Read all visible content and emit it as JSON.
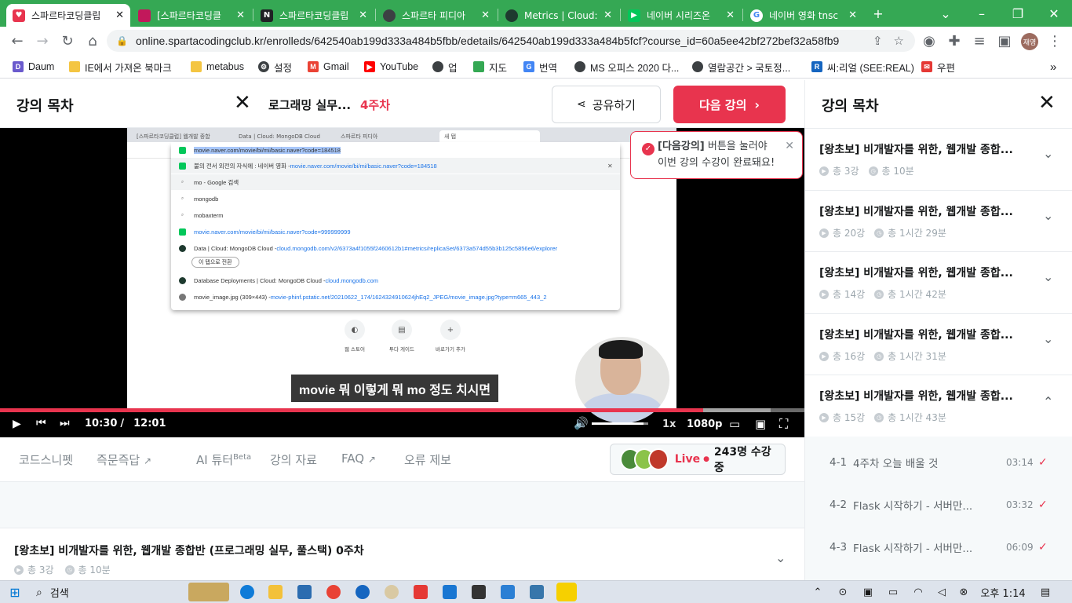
{
  "browser": {
    "tabs": [
      {
        "title": "스파르타코딩클립",
        "active": true,
        "favicon_color": "#e8344e"
      },
      {
        "title": "[스파르타코딩클",
        "active": false,
        "favicon_color": "#c2185b"
      },
      {
        "title": "스파르타코딩클립",
        "active": false,
        "favicon_color": "#202124"
      },
      {
        "title": "스파르타 피디아",
        "active": false,
        "favicon_color": "#3c4043"
      },
      {
        "title": "Metrics | Cloud:",
        "active": false,
        "favicon_color": "#1e3a2f"
      },
      {
        "title": "네이버 시리즈온",
        "active": false,
        "favicon_color": "#03c75a"
      },
      {
        "title": "네이버 영화 tnsc",
        "active": false,
        "favicon_color": "#4285f4"
      }
    ],
    "new_tab": "+",
    "url": "online.spartacodingclub.kr/enrolleds/642540ab199d333a484b5fbb/edetails/642540ab199d333a484b5fcf?course_id=60a5ee42bf272bef32a58fb9",
    "profile_label": "재영",
    "bookmarks": [
      {
        "label": "Daum",
        "icon_color": "#6a5acd"
      },
      {
        "label": "IE에서 가져온 북마크",
        "icon_color": "#f4c542"
      },
      {
        "label": "metabus",
        "icon_color": "#f4c542"
      },
      {
        "label": "설정",
        "icon_color": "#3c4043"
      },
      {
        "label": "Gmail",
        "icon_color": "#ea4335"
      },
      {
        "label": "YouTube",
        "icon_color": "#ff0000"
      },
      {
        "label": "업",
        "icon_color": "#3c4043"
      },
      {
        "label": "지도",
        "icon_color": "#34a853"
      },
      {
        "label": "번역",
        "icon_color": "#4285f4"
      },
      {
        "label": "MS 오피스 2020 다...",
        "icon_color": "#3c4043"
      },
      {
        "label": "열람공간 > 국토정...",
        "icon_color": "#3c4043"
      },
      {
        "label": "씨:리얼 (SEE:REAL)",
        "icon_color": "#1565c0"
      },
      {
        "label": "우편",
        "icon_color": "#e53935"
      }
    ],
    "more": "»"
  },
  "header": {
    "toc_title": "강의 목차",
    "course_name": "로그래밍 실무...",
    "week": "4주차",
    "share_label": "공유하기",
    "next_label": "다음 강의"
  },
  "tooltip": {
    "bold": "[다음강의]",
    "line1_rest": " 버튼을 눌러야",
    "line2": "이번 강의 수강이 완료돼요!"
  },
  "video": {
    "inner": {
      "tabs": [
        "[스파르타코딩클럽] 웹개발 종합",
        "Data | Cloud: MongoDB Cloud",
        "스파르타 피디아",
        "새 탭"
      ],
      "address": "movie.naver.com/movie/bi/mi/basic.naver?code=184518",
      "suggestions": [
        {
          "text": "movie.naver.com/movie/bi/mi/basic.naver?code=184518",
          "link": "",
          "type": "url",
          "highlight": true
        },
        {
          "text": "불의 전서 외전의 자식에 : 네이버 영화 - ",
          "link": "movie.naver.com/movie/bi/mi/basic.naver?code=184518",
          "type": "site"
        },
        {
          "text": "mo - Google 검색",
          "link": "",
          "type": "search"
        },
        {
          "text": "mongodb",
          "link": "",
          "type": "search"
        },
        {
          "text": "mobaxterm",
          "link": "",
          "type": "search"
        },
        {
          "text": "",
          "link": "movie.naver.com/movie/bi/mi/basic.naver?code=999999999",
          "type": "site"
        },
        {
          "text": "Data | Cloud: MongoDB Cloud - ",
          "link": "cloud.mongodb.com/v2/6373a4f1055f2460612b1#metrics/replicaSet/6373a574d55b3b125c5856e6/explorer",
          "type": "mongo"
        },
        {
          "text": "Database Deployments | Cloud: MongoDB Cloud - ",
          "link": "cloud.mongodb.com",
          "type": "mongo"
        },
        {
          "text": "movie_image.jpg (309×443) - ",
          "link": "movie-phinf.pstatic.net/20210622_174/1624324910624jhEq2_JPEG/movie_image.jpg?type=m665_443_2",
          "type": "globe"
        }
      ],
      "switch_tab_label": "이 탭으로 전환",
      "shortcuts": [
        "웹 스토어",
        "투다 게이드",
        "바로가기 추가"
      ]
    },
    "subtitle": "movie 뭐 이렇게 뭐 mo 정도 치시면",
    "current_time": "10:30",
    "duration": "12:01",
    "progress": 0.874,
    "buffered": 0.958,
    "volume": 0.92,
    "speed": "1x",
    "quality": "1080p"
  },
  "subnav": {
    "items": [
      "코드스니펫",
      "즉문즉답",
      "AI 튜터",
      "강의 자료",
      "FAQ",
      "오류 제보"
    ],
    "ai_badge": "Beta",
    "live_label": "Live",
    "live_count": "243명 수강 중"
  },
  "bottom_section": {
    "title": "[왕초보] 비개발자를 위한, 웹개발 종합반 (프로그래밍 실무, 풀스택) 0주차",
    "lectures": "총 3강",
    "time": "총 10분"
  },
  "sidebar": {
    "title": "강의 목차",
    "sections": [
      {
        "title": "[왕초보] 비개발자를 위한, 웹개발 종합...",
        "lectures": "총 3강",
        "time": "총 10분",
        "expanded": false
      },
      {
        "title": "[왕초보] 비개발자를 위한, 웹개발 종합...",
        "lectures": "총 20강",
        "time": "총 1시간 29분",
        "expanded": false
      },
      {
        "title": "[왕초보] 비개발자를 위한, 웹개발 종합...",
        "lectures": "총 14강",
        "time": "총 1시간 42분",
        "expanded": false
      },
      {
        "title": "[왕초보] 비개발자를 위한, 웹개발 종합...",
        "lectures": "총 16강",
        "time": "총 1시간 31분",
        "expanded": false
      },
      {
        "title": "[왕초보] 비개발자를 위한, 웹개발 종합...",
        "lectures": "총 15강",
        "time": "총 1시간 43분",
        "expanded": true
      }
    ],
    "lessons": [
      {
        "no": "4-1",
        "name": "4주차 오늘 배울 것",
        "duration": "03:14",
        "done": true
      },
      {
        "no": "4-2",
        "name": "Flask 시작하기 - 서버만...",
        "duration": "03:32",
        "done": true
      },
      {
        "no": "4-3",
        "name": "Flask 시작하기 - 서버만...",
        "duration": "06:09",
        "done": true
      }
    ]
  },
  "taskbar": {
    "search_label": "검색",
    "time": "오후 1:14",
    "accent": "#0078d4"
  },
  "colors": {
    "brand_red": "#e8344e",
    "chrome_green": "#35a854"
  }
}
